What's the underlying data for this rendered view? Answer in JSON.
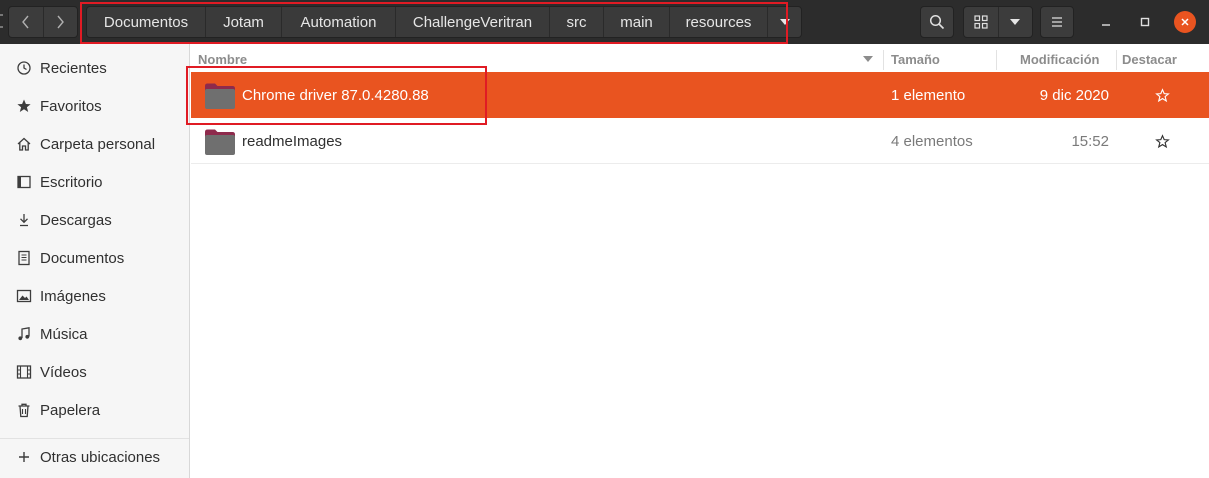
{
  "window": {
    "nav_back_icon": "chevron-left-icon",
    "nav_forward_icon": "chevron-right-icon",
    "search_icon": "search-icon",
    "view_icon": "grid-view-icon",
    "menu_icon": "hamburger-menu-icon"
  },
  "pathbar": {
    "crumbs": [
      {
        "label": "Documentos"
      },
      {
        "label": "Jotam"
      },
      {
        "label": "Automation"
      },
      {
        "label": "ChallengeVeritran"
      },
      {
        "label": "src"
      },
      {
        "label": "main"
      },
      {
        "label": "resources"
      }
    ],
    "menu_icon": "triangle-down-icon"
  },
  "sidebar": {
    "items": [
      {
        "label": "Recientes",
        "icon": "recent-clock-icon"
      },
      {
        "label": "Favoritos",
        "icon": "star-icon"
      },
      {
        "label": "Carpeta personal",
        "icon": "home-icon"
      },
      {
        "label": "Escritorio",
        "icon": "desktop-icon"
      },
      {
        "label": "Descargas",
        "icon": "download-icon"
      },
      {
        "label": "Documentos",
        "icon": "document-icon"
      },
      {
        "label": "Imágenes",
        "icon": "image-icon"
      },
      {
        "label": "Música",
        "icon": "music-icon"
      },
      {
        "label": "Vídeos",
        "icon": "video-icon"
      },
      {
        "label": "Papelera",
        "icon": "trash-icon"
      }
    ],
    "other_locations": {
      "label": "Otras ubicaciones",
      "icon": "plus-icon"
    }
  },
  "columns": {
    "name": "Nombre",
    "size": "Tamaño",
    "modified": "Modificación",
    "starred": "Destacar"
  },
  "files": [
    {
      "name": "Chrome driver 87.0.4280.88",
      "size": "1 elemento",
      "modified": "9 dic 2020",
      "selected": true
    },
    {
      "name": "readmeImages",
      "size": "4 elementos",
      "modified": "15:52",
      "selected": false
    }
  ],
  "colors": {
    "accent": "#e95420",
    "headerbar": "#2c2c2c",
    "annotation": "#e01b24"
  }
}
